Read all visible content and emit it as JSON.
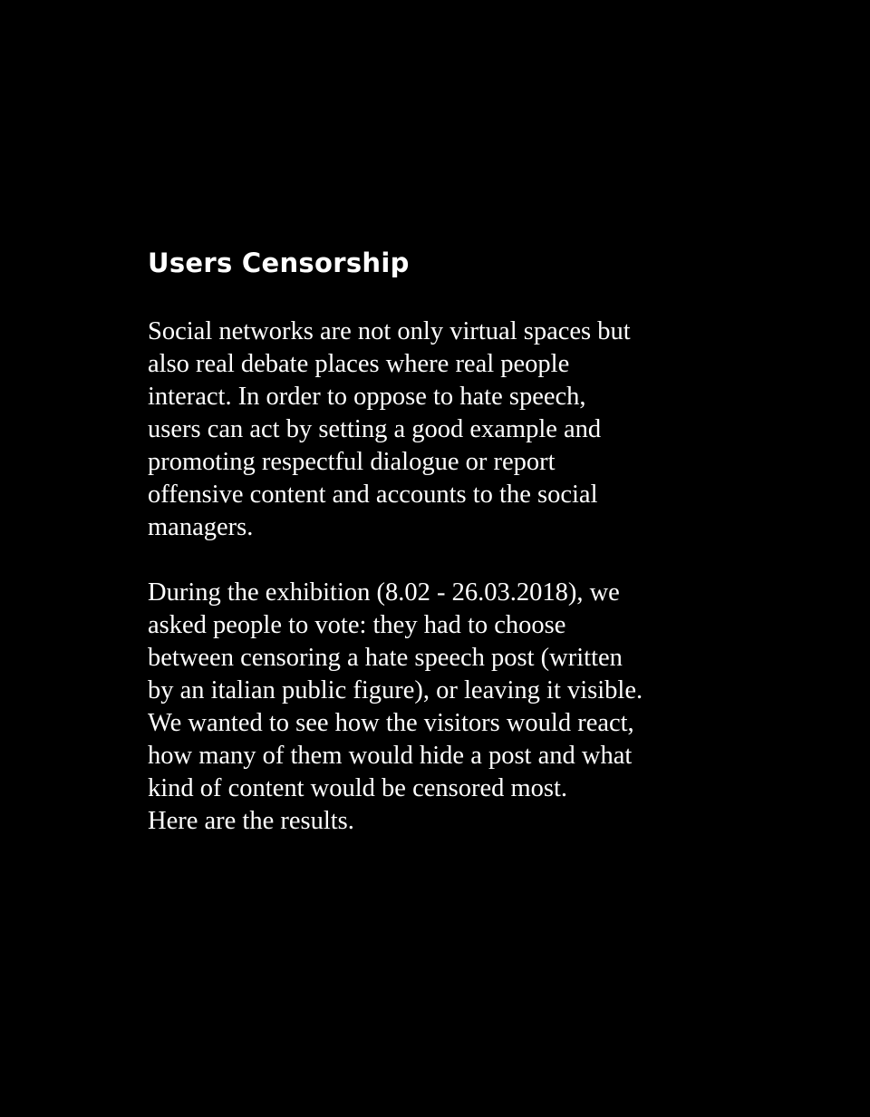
{
  "page": {
    "title": "Users Censorship",
    "paragraph_1_lines": [
      "Social networks are not only virtual spaces but",
      "also real debate places where real people",
      "interact. In order to oppose to hate speech,",
      "users can act by setting a good example and",
      "promoting respectful dialogue or report",
      "offensive content and accounts to the social",
      "managers."
    ],
    "paragraph_2_lines": [
      "During the exhibition (8.02 - 26.03.2018), we",
      "asked people to vote: they had to choose",
      "between censoring a hate speech post (written",
      "by an italian public figure), or leaving it visible.",
      "We wanted to see how the visitors would react,",
      "how many of them would hide a post and what",
      "kind of content would be censored most.",
      "Here are the results."
    ]
  },
  "colors": {
    "background": "#000000",
    "text": "#ffffff"
  }
}
